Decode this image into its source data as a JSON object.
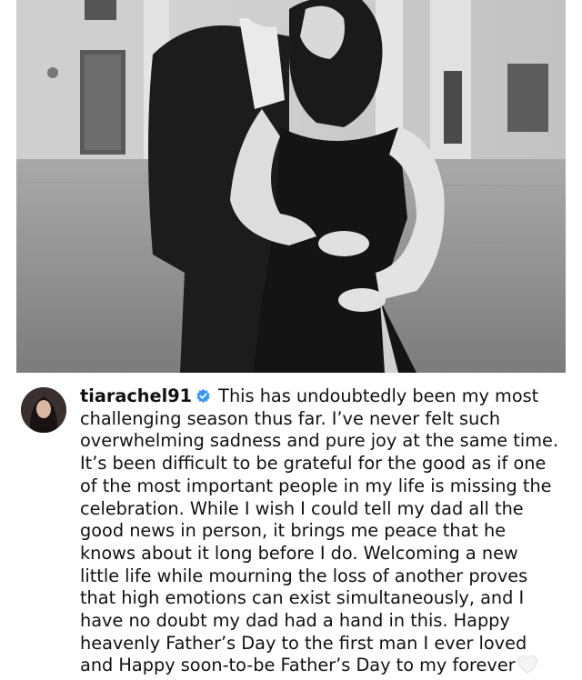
{
  "post": {
    "image_alt": "Black-and-white photo of a man in a suit embracing a pregnant woman in a dark dress",
    "username": "tiarachel91",
    "verified_icon": "verified-badge-icon",
    "caption_first_line": "This has undoubtedly been my most",
    "caption_lines": [
      "challenging season thus far. I’ve never felt such",
      "overwhelming sadness and pure joy at the same time.",
      "It’s been difficult to be grateful for the good as if one",
      "of the most important people in my life is missing the",
      "celebration. While I wish I could tell my dad all the",
      "good news in person, it brings me peace that he",
      "knows about it long before I do. Welcoming a new",
      "little life while mourning the loss of another proves",
      "that high emotions can exist simultaneously, and I",
      "have no doubt my dad had a hand in this. Happy",
      "heavenly Father’s Day to the first man I ever loved"
    ],
    "caption_last_line": "and Happy soon-to-be Father’s Day to my forever",
    "trailing_icon": "white-heart-icon"
  },
  "colors": {
    "verified": "#3897f0",
    "text": "#111111",
    "background": "#ffffff"
  }
}
